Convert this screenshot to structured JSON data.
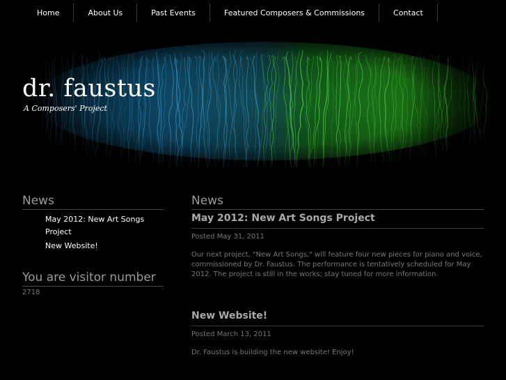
{
  "nav": {
    "items": [
      "Home",
      "About Us",
      "Past Events",
      "Featured Composers & Commissions",
      "Contact"
    ]
  },
  "header": {
    "title": "dr. faustus",
    "tagline": "A Composers' Project"
  },
  "colors": {
    "background": "#000000",
    "banner_blue": "#1a6f9e",
    "banner_green": "#2fbf2a"
  },
  "sidebar": {
    "news_heading": "News",
    "news_items": [
      "May 2012: New Art Songs Project",
      "New Website!"
    ],
    "visitor_heading": "You are visitor number",
    "visitor_count": "2718"
  },
  "main": {
    "heading": "News",
    "posts": [
      {
        "title": "May 2012: New Art Songs Project",
        "meta": "Posted May 31, 2011",
        "body": "Our next project, \"New Art Songs,\" will feature four new pieces for piano and voice, commissioned by Dr. Faustus. The performance is tentatively scheduled for May 2012. The project is still in the works; stay tuned for more information."
      },
      {
        "title": "New Website!",
        "meta": "Posted March 13, 2011",
        "body": "Dr. Faustus is building the new website! Enjoy!"
      }
    ]
  }
}
